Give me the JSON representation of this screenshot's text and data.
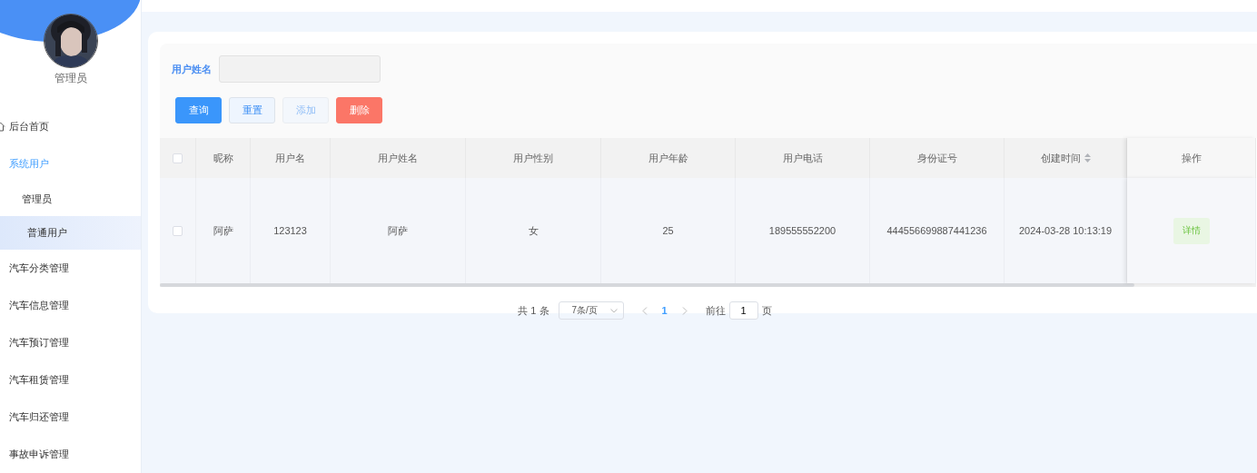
{
  "sidebar": {
    "user": {
      "name": "管理员"
    },
    "items": [
      {
        "label": "后台首页",
        "selected": false
      },
      {
        "label": "系统用户",
        "selected": true,
        "children": [
          {
            "label": "管理员",
            "selected": false
          },
          {
            "label": "普通用户",
            "selected": true
          }
        ]
      },
      {
        "label": "汽车分类管理",
        "selected": false
      },
      {
        "label": "汽车信息管理",
        "selected": false
      },
      {
        "label": "汽车预订管理",
        "selected": false
      },
      {
        "label": "汽车租赁管理",
        "selected": false
      },
      {
        "label": "汽车归还管理",
        "selected": false
      },
      {
        "label": "事故申诉管理",
        "selected": false
      }
    ]
  },
  "search": {
    "label": "用户姓名"
  },
  "buttons": [
    {
      "label": "查询",
      "kind": "primary",
      "disabled": false
    },
    {
      "label": "重置",
      "kind": "plain",
      "disabled": false
    },
    {
      "label": "添加",
      "kind": "plain",
      "disabled": true
    },
    {
      "label": "删除",
      "kind": "danger",
      "disabled": false
    }
  ],
  "table": {
    "columns": [
      {
        "label": "昵称",
        "sortable": false
      },
      {
        "label": "用户名",
        "sortable": false
      },
      {
        "label": "用户姓名",
        "sortable": false
      },
      {
        "label": "用户性别",
        "sortable": false
      },
      {
        "label": "用户年龄",
        "sortable": false
      },
      {
        "label": "用户电话",
        "sortable": false
      },
      {
        "label": "身份证号",
        "sortable": false
      },
      {
        "label": "创建时间",
        "sortable": true
      },
      {
        "label": "操作",
        "sortable": false
      }
    ],
    "all_checked": false,
    "rows": [
      {
        "checked": false,
        "cells": [
          "阿萨",
          "123123",
          "阿萨",
          "女",
          "25",
          "189555552200",
          "444556699887441236",
          "2024-03-28 10:13:19"
        ],
        "action": "详情"
      }
    ]
  },
  "pagination": {
    "total": "共 1 条",
    "page_size": "7条/页",
    "pages": [
      {
        "label": "1",
        "selected": true
      }
    ],
    "goto_label": "前往",
    "goto_value": "1",
    "goto_suffix": "页"
  }
}
